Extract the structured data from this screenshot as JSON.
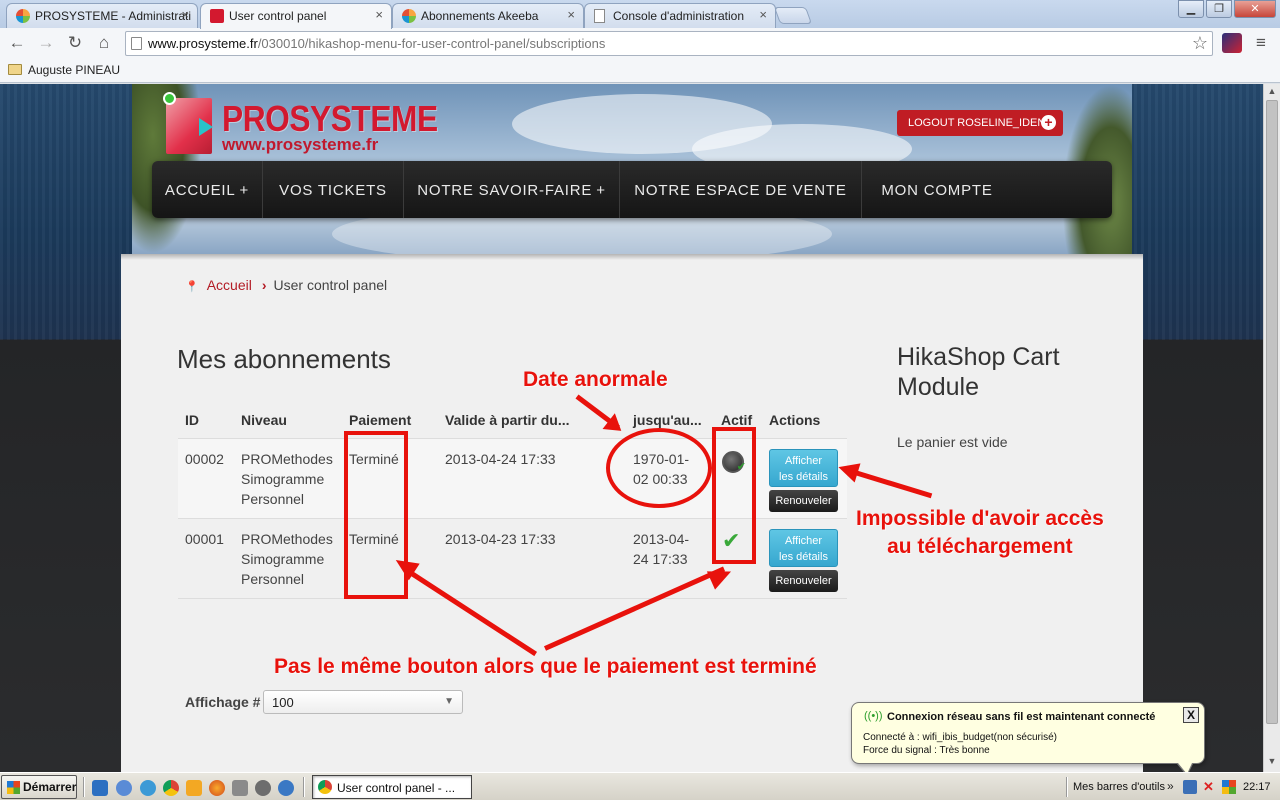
{
  "browser": {
    "tabs": [
      {
        "label": "PROSYSTEME - Administrati",
        "active": false
      },
      {
        "label": "User control panel",
        "active": true
      },
      {
        "label": "Abonnements Akeeba",
        "active": false
      },
      {
        "label": "Console d'administration",
        "active": false
      }
    ],
    "url_domain": "www.prosysteme.fr",
    "url_path": "/030010/hikashop-menu-for-user-control-panel/subscriptions",
    "bookmark_folder": "Auguste PINEAU",
    "icons": [
      "back-icon",
      "forward-icon",
      "reload-icon",
      "home-icon",
      "star-icon"
    ]
  },
  "site": {
    "logo_text": "PROSYSTEME",
    "logo_url": "www.prosysteme.fr",
    "logout_label": "LOGOUT ROSELINE_IDENT",
    "nav": [
      {
        "label": "ACCUEIL",
        "caret": "+"
      },
      {
        "label": "VOS TICKETS",
        "caret": ""
      },
      {
        "label": "NOTRE SAVOIR-FAIRE",
        "caret": "+"
      },
      {
        "label": "NOTRE ESPACE DE VENTE",
        "caret": ""
      },
      {
        "label": "MON COMPTE",
        "caret": ""
      }
    ],
    "colors": {
      "brand_red": "#d3192f",
      "nav_bg": "#1e1e1e",
      "detail_button": "#36a7cf",
      "annotation_red": "#e8120c"
    }
  },
  "breadcrumb": {
    "home": "Accueil",
    "current": "User control panel"
  },
  "subscriptions": {
    "title": "Mes abonnements",
    "columns": [
      "ID",
      "Niveau",
      "Paiement",
      "Valide à partir du...",
      "jusqu'au...",
      "Actif",
      "Actions"
    ],
    "rows": [
      {
        "id": "00002",
        "niveau_1": "PROMethodes",
        "niveau_2": "Simogramme",
        "niveau_3": "Personnel",
        "paiement": "Terminé",
        "from": "2013-04-24 17:33",
        "to_1": "1970-01-",
        "to_2": "02 00:33",
        "actif_icon": "clock-icon",
        "details_label_1": "Afficher",
        "details_label_2": "les détails",
        "renew_label": "Renouveler"
      },
      {
        "id": "00001",
        "niveau_1": "PROMethodes",
        "niveau_2": "Simogramme",
        "niveau_3": "Personnel",
        "paiement": "Terminé",
        "from": "2013-04-23 17:33",
        "to_1": "2013-04-",
        "to_2": "24 17:33",
        "actif_icon": "check-icon",
        "details_label_1": "Afficher",
        "details_label_2": "les détails",
        "renew_label": "Renouveler"
      }
    ],
    "display_label": "Affichage #",
    "display_value": "100"
  },
  "sidebar": {
    "title_1": "HikaShop Cart",
    "title_2": "Module",
    "empty_text": "Le panier est vide"
  },
  "annotations": {
    "date": "Date anormale",
    "access_1": "Impossible d'avoir accès",
    "access_2": "au téléchargement",
    "button": "Pas le même bouton alors que le paiement est terminé"
  },
  "notification": {
    "title": "Connexion réseau sans fil est maintenant connecté",
    "line1": "Connecté à : wifi_ibis_budget(non sécurisé)",
    "line2": "Force du signal : Très bonne",
    "close": "X"
  },
  "taskbar": {
    "start": "Démarrer",
    "window": "User control panel - ...",
    "toolbars": "Mes barres d'outils",
    "chevron": "»",
    "time": "22:17"
  }
}
